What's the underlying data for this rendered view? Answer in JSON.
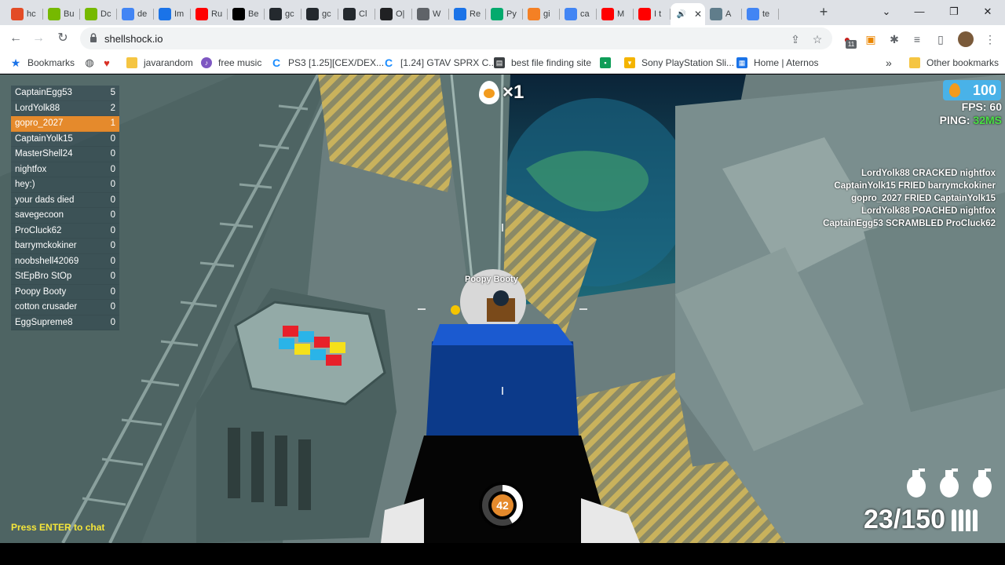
{
  "browser": {
    "tabs": [
      {
        "label": "hc",
        "icon": "multicolor-icon",
        "color": "#e34c26"
      },
      {
        "label": "Bu",
        "icon": "nvidia-icon",
        "color": "#76b900"
      },
      {
        "label": "Dc",
        "icon": "nvidia-icon",
        "color": "#76b900"
      },
      {
        "label": "de",
        "icon": "google-icon",
        "color": "#4285f4"
      },
      {
        "label": "Im",
        "icon": "chart-icon",
        "color": "#1a73e8"
      },
      {
        "label": "Ru",
        "icon": "youtube-icon",
        "color": "#ff0000"
      },
      {
        "label": "Be",
        "icon": "medium-icon",
        "color": "#000000"
      },
      {
        "label": "gc",
        "icon": "github-icon",
        "color": "#24292e"
      },
      {
        "label": "gc",
        "icon": "github-icon",
        "color": "#24292e"
      },
      {
        "label": "Cl",
        "icon": "github-icon",
        "color": "#24292e"
      },
      {
        "label": "O|",
        "icon": "openai-icon",
        "color": "#202123"
      },
      {
        "label": "W",
        "icon": "globe-icon",
        "color": "#5f6368"
      },
      {
        "label": "Re",
        "icon": "dot-icon",
        "color": "#1a73e8"
      },
      {
        "label": "Py",
        "icon": "w3-icon",
        "color": "#04aa6d"
      },
      {
        "label": "gi",
        "icon": "stack-icon",
        "color": "#f48024"
      },
      {
        "label": "ca",
        "icon": "google-icon",
        "color": "#4285f4"
      },
      {
        "label": "M",
        "icon": "youtube-icon",
        "color": "#ff0000"
      },
      {
        "label": "I t",
        "icon": "youtube-icon",
        "color": "#ff0000"
      },
      {
        "label": "",
        "icon": "speaker-icon",
        "color": "#3c4043",
        "active": true
      },
      {
        "label": "A",
        "icon": "image-icon",
        "color": "#607d8b"
      },
      {
        "label": "te",
        "icon": "google-icon",
        "color": "#4285f4"
      }
    ],
    "url": "shellshock.io",
    "bookmarks": [
      {
        "label": "Bookmarks",
        "icon": "star-icon"
      },
      {
        "label": "",
        "icon": "globe-icon"
      },
      {
        "label": "",
        "icon": "heart-icon"
      },
      {
        "label": "javarandom",
        "icon": "folder-icon"
      },
      {
        "label": "free music",
        "icon": "music-icon"
      },
      {
        "label": "PS3 [1.25][CEX/DEX...",
        "icon": "c-icon"
      },
      {
        "label": "[1.24] GTAV SPRX C...",
        "icon": "c-icon"
      },
      {
        "label": "best file finding site",
        "icon": "printer-icon"
      },
      {
        "label": "",
        "icon": "green-square-icon"
      },
      {
        "label": "Sony PlayStation Sli...",
        "icon": "bag-icon"
      },
      {
        "label": "Home | Aternos",
        "icon": "aternos-icon"
      },
      {
        "label": "Other bookmarks",
        "icon": "folder-icon"
      }
    ],
    "extension_badge": "11"
  },
  "game": {
    "scoreboard": [
      {
        "name": "CaptainEgg53",
        "score": "5"
      },
      {
        "name": "LordYolk88",
        "score": "2"
      },
      {
        "name": "gopro_2027",
        "score": "1",
        "me": true
      },
      {
        "name": "CaptainYolk15",
        "score": "0"
      },
      {
        "name": "MasterShell24",
        "score": "0"
      },
      {
        "name": "nightfox",
        "score": "0"
      },
      {
        "name": "hey:)",
        "score": "0"
      },
      {
        "name": "your dads died",
        "score": "0"
      },
      {
        "name": "savegecoon",
        "score": "0"
      },
      {
        "name": "ProCluck62",
        "score": "0"
      },
      {
        "name": "barrymckokiner",
        "score": "0"
      },
      {
        "name": "noobshell42069",
        "score": "0"
      },
      {
        "name": "StEpBro StOp",
        "score": "0"
      },
      {
        "name": "Poopy Booty",
        "score": "0"
      },
      {
        "name": "cotton crusader",
        "score": "0"
      },
      {
        "name": "EggSupreme8",
        "score": "0"
      }
    ],
    "killfeed": [
      "LordYolk88 CRACKED nightfox",
      "CaptainYolk15 FRIED barrymckokiner",
      "gopro_2027 FRIED CaptainYolk15",
      "LordYolk88 POACHED nightfox",
      "CaptainEgg53 SCRAMBLED ProCluck62"
    ],
    "streak": "×1",
    "eggs": "100",
    "fps_label": "FPS:",
    "fps": "60",
    "ping_label": "PING:",
    "ping": "32MS",
    "health": "42",
    "health_fraction": 0.42,
    "ammo": "23/150",
    "grenades": 3,
    "chat_hint": "Press ENTER to chat",
    "enemy_name": "Poopy Booty",
    "colors": {
      "accent": "#e58a2c",
      "eggs_badge": "#49b2e8",
      "ping_good": "#4be046",
      "chat_hint": "#f5e53a"
    }
  }
}
